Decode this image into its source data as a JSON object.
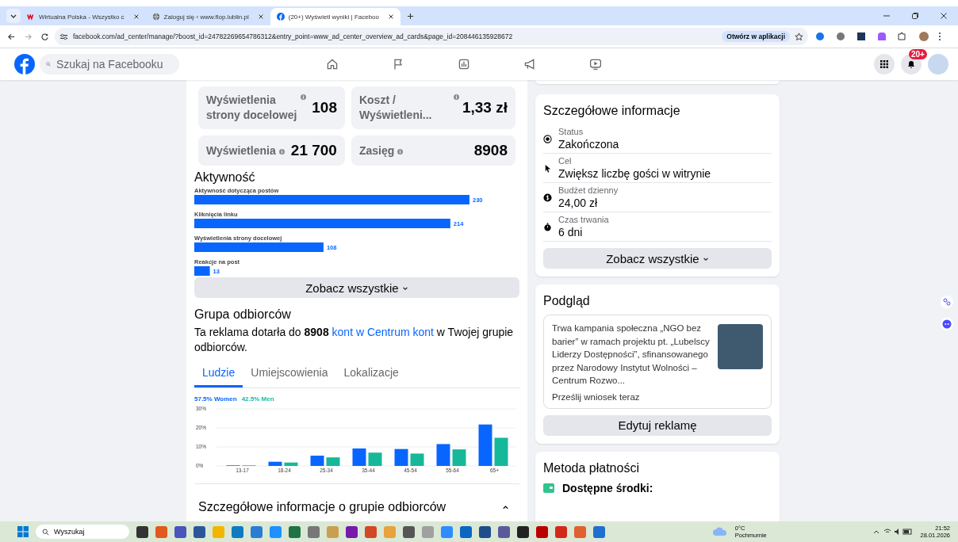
{
  "browser": {
    "tabs": [
      {
        "title": "Wirtualna Polska - Wszystko c",
        "kind": "wp",
        "selected": false
      },
      {
        "title": "Zaloguj się ‹ www.flop.lublin.pl",
        "kind": "globe",
        "selected": false
      },
      {
        "title": "(20+) Wyświetl wyniki | Faceboo",
        "kind": "fb",
        "selected": true
      }
    ],
    "url": "facebook.com/ad_center/manage/?boost_id=24782269654786312&entry_point=www_ad_center_overview_ad_cards&page_id=208446135928672",
    "open_in_app": "Otwórz w aplikacji"
  },
  "facebook": {
    "search_placeholder": "Szukaj na Facebooku",
    "notification_badge": "20+"
  },
  "metrics": [
    {
      "label": "Wyświetlenia strony docelowej",
      "value": "108"
    },
    {
      "label": "Koszt / Wyświetleni...",
      "value": "1,33 zł"
    },
    {
      "label": "Wyświetlenia",
      "value": "21 700"
    },
    {
      "label": "Zasięg",
      "value": "8908"
    }
  ],
  "activity": {
    "title": "Aktywność",
    "chart_data": {
      "type": "bar",
      "orientation": "horizontal",
      "categories": [
        "Aktywność dotycząca postów",
        "Kliknięcia linku",
        "Wyświetlenia strony docelowej",
        "Reakcje na post"
      ],
      "values": [
        230,
        214,
        108,
        13
      ],
      "data_labels": true
    },
    "see_all": "Zobacz wszystkie"
  },
  "audience": {
    "title": "Grupa odbiorców",
    "text_before": "Ta reklama dotarła do **8908** ",
    "link": "kont w Centrum kont",
    "text_after": " w Twojej grupie odbiorców.",
    "tabs": [
      {
        "label": "Ludzie",
        "selected": true
      },
      {
        "label": "Umiejscowienia",
        "selected": false
      },
      {
        "label": "Lokalizacje",
        "selected": false
      }
    ],
    "shares": [
      "57.5%",
      "42.5%"
    ],
    "chart_data": {
      "type": "bar",
      "categories": [
        "13-17",
        "18-24",
        "25-34",
        "35-44",
        "45-54",
        "55-64",
        "65+"
      ],
      "series": [
        {
          "name": "Women",
          "color": "#0866ff",
          "values": [
            0.3,
            2.2,
            5.4,
            9.2,
            8.9,
            11.5,
            21.8
          ]
        },
        {
          "name": "Men",
          "color": "#16b89a",
          "values": [
            0.3,
            1.8,
            4.5,
            7.0,
            6.5,
            8.7,
            14.8
          ]
        }
      ],
      "ylim": [
        0,
        30
      ],
      "yticks": [
        {
          "value": 0,
          "label": "0%"
        },
        {
          "value": 10,
          "label": "10%"
        },
        {
          "value": 20,
          "label": "20%"
        },
        {
          "value": 30,
          "label": "30%"
        }
      ]
    },
    "details_title": "Szczegółowe informacje o grupie odbiorców",
    "details_expanded": true
  },
  "details": {
    "title": "Szczegółowe informacje",
    "items": [
      {
        "kind": "status",
        "label": "Status",
        "value": "Zakończona"
      },
      {
        "kind": "goal",
        "label": "Cel",
        "value": "Zwiększ liczbę gości w witrynie"
      },
      {
        "kind": "budget",
        "label": "Budżet dzienny",
        "value": "24,00 zł"
      },
      {
        "kind": "duration",
        "label": "Czas trwania",
        "value": "6 dni"
      }
    ],
    "see_all": "Zobacz wszystkie"
  },
  "preview": {
    "title": "Podgląd",
    "text": "Trwa kampania społeczna „NGO bez barier” w ramach projektu pt. „Lubelscy Liderzy Dostępności”, sfinansowanego przez Narodowy Instytut Wolności – Centrum Rozwo...",
    "cta": "Prześlij wniosek teraz",
    "edit": "Edytuj reklamę"
  },
  "payment": {
    "title": "Metoda płatności",
    "funds": "Dostępne środki:"
  },
  "taskbar": {
    "search": "Wyszukaj",
    "temperature": "0°C",
    "weather": "Pochmurnie",
    "time": "21:52",
    "date": "28.01.2026"
  }
}
